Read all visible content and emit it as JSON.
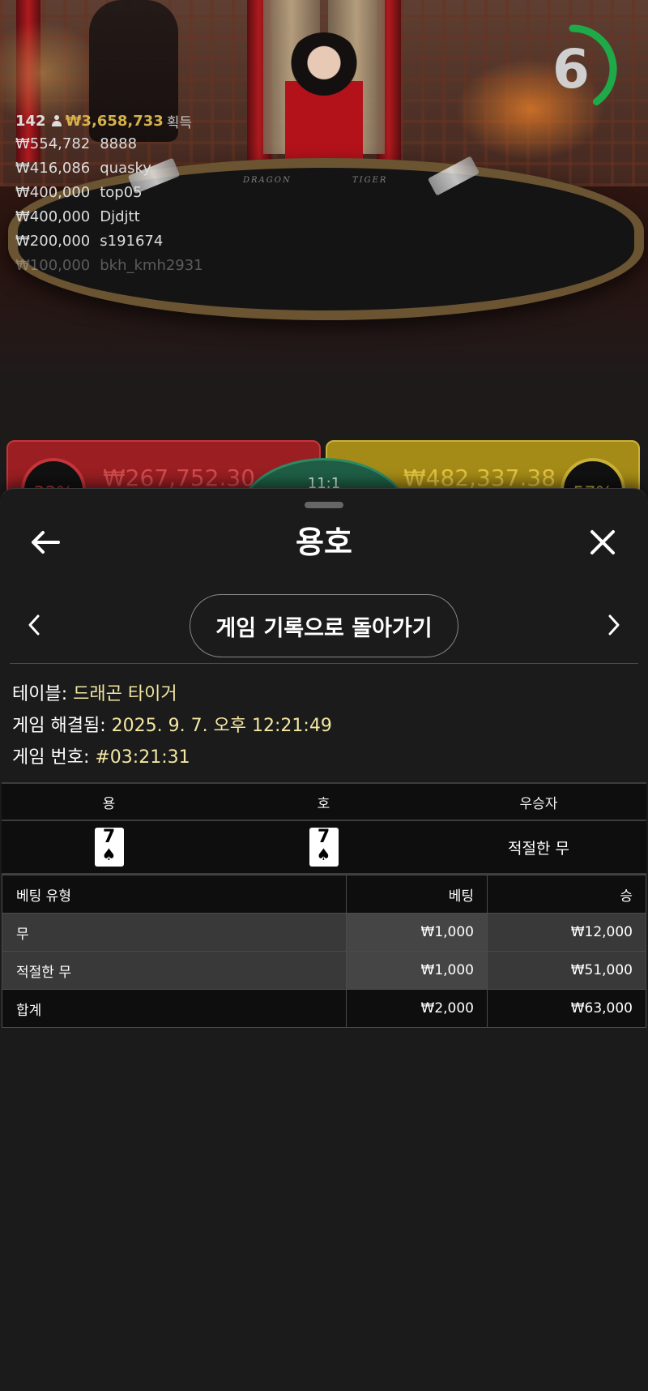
{
  "live": {
    "winners": {
      "count": "142",
      "total": "₩3,658,733",
      "label": "획득",
      "rows": [
        {
          "amount": "₩554,782",
          "name": "8888"
        },
        {
          "amount": "₩416,086",
          "name": "quasky"
        },
        {
          "amount": "₩400,000",
          "name": "top05"
        },
        {
          "amount": "₩400,000",
          "name": "Djdjtt"
        },
        {
          "amount": "₩200,000",
          "name": "s191674"
        },
        {
          "amount": "₩100,000",
          "name": "bkh_kmh2931"
        }
      ]
    },
    "felt_labels": {
      "dragon": "DRAGON",
      "tiger": "TIGER"
    },
    "timer": {
      "seconds": "6",
      "remaining_fraction": 0.4,
      "color": "#1faa4a"
    },
    "bet_panels": {
      "dragon": {
        "percent": "33%",
        "amount": "₩267,752.30",
        "color": "#9a1e22"
      },
      "tiger": {
        "percent": "57%",
        "amount": "₩482,337.38",
        "color": "#a48a16"
      },
      "tie": {
        "odds": "11:1",
        "color": "#1f5e45"
      }
    }
  },
  "sheet": {
    "title": "용호",
    "back_icon": "arrow-left-icon",
    "close_icon": "close-icon",
    "return_button": "게임 기록으로 돌아가기",
    "info": {
      "table_label": "테이블:",
      "table_value": "드래곤 타이거",
      "resolved_label": "게임 해결됨:",
      "resolved_value": "2025. 9. 7. 오후 12:21:49",
      "game_no_label": "게임 번호:",
      "game_no_value": "#03:21:31"
    },
    "result": {
      "headers": [
        "용",
        "호",
        "우승자"
      ],
      "dragon_card": {
        "rank": "7",
        "suit": "♠"
      },
      "tiger_card": {
        "rank": "7",
        "suit": "♠"
      },
      "winner": "적절한 무"
    },
    "bets": {
      "headers": [
        "베팅 유형",
        "베팅",
        "승"
      ],
      "rows": [
        {
          "type": "무",
          "bet": "₩1,000",
          "win": "₩12,000"
        },
        {
          "type": "적절한 무",
          "bet": "₩1,000",
          "win": "₩51,000"
        }
      ],
      "total": {
        "type": "합계",
        "bet": "₩2,000",
        "win": "₩63,000"
      }
    }
  }
}
